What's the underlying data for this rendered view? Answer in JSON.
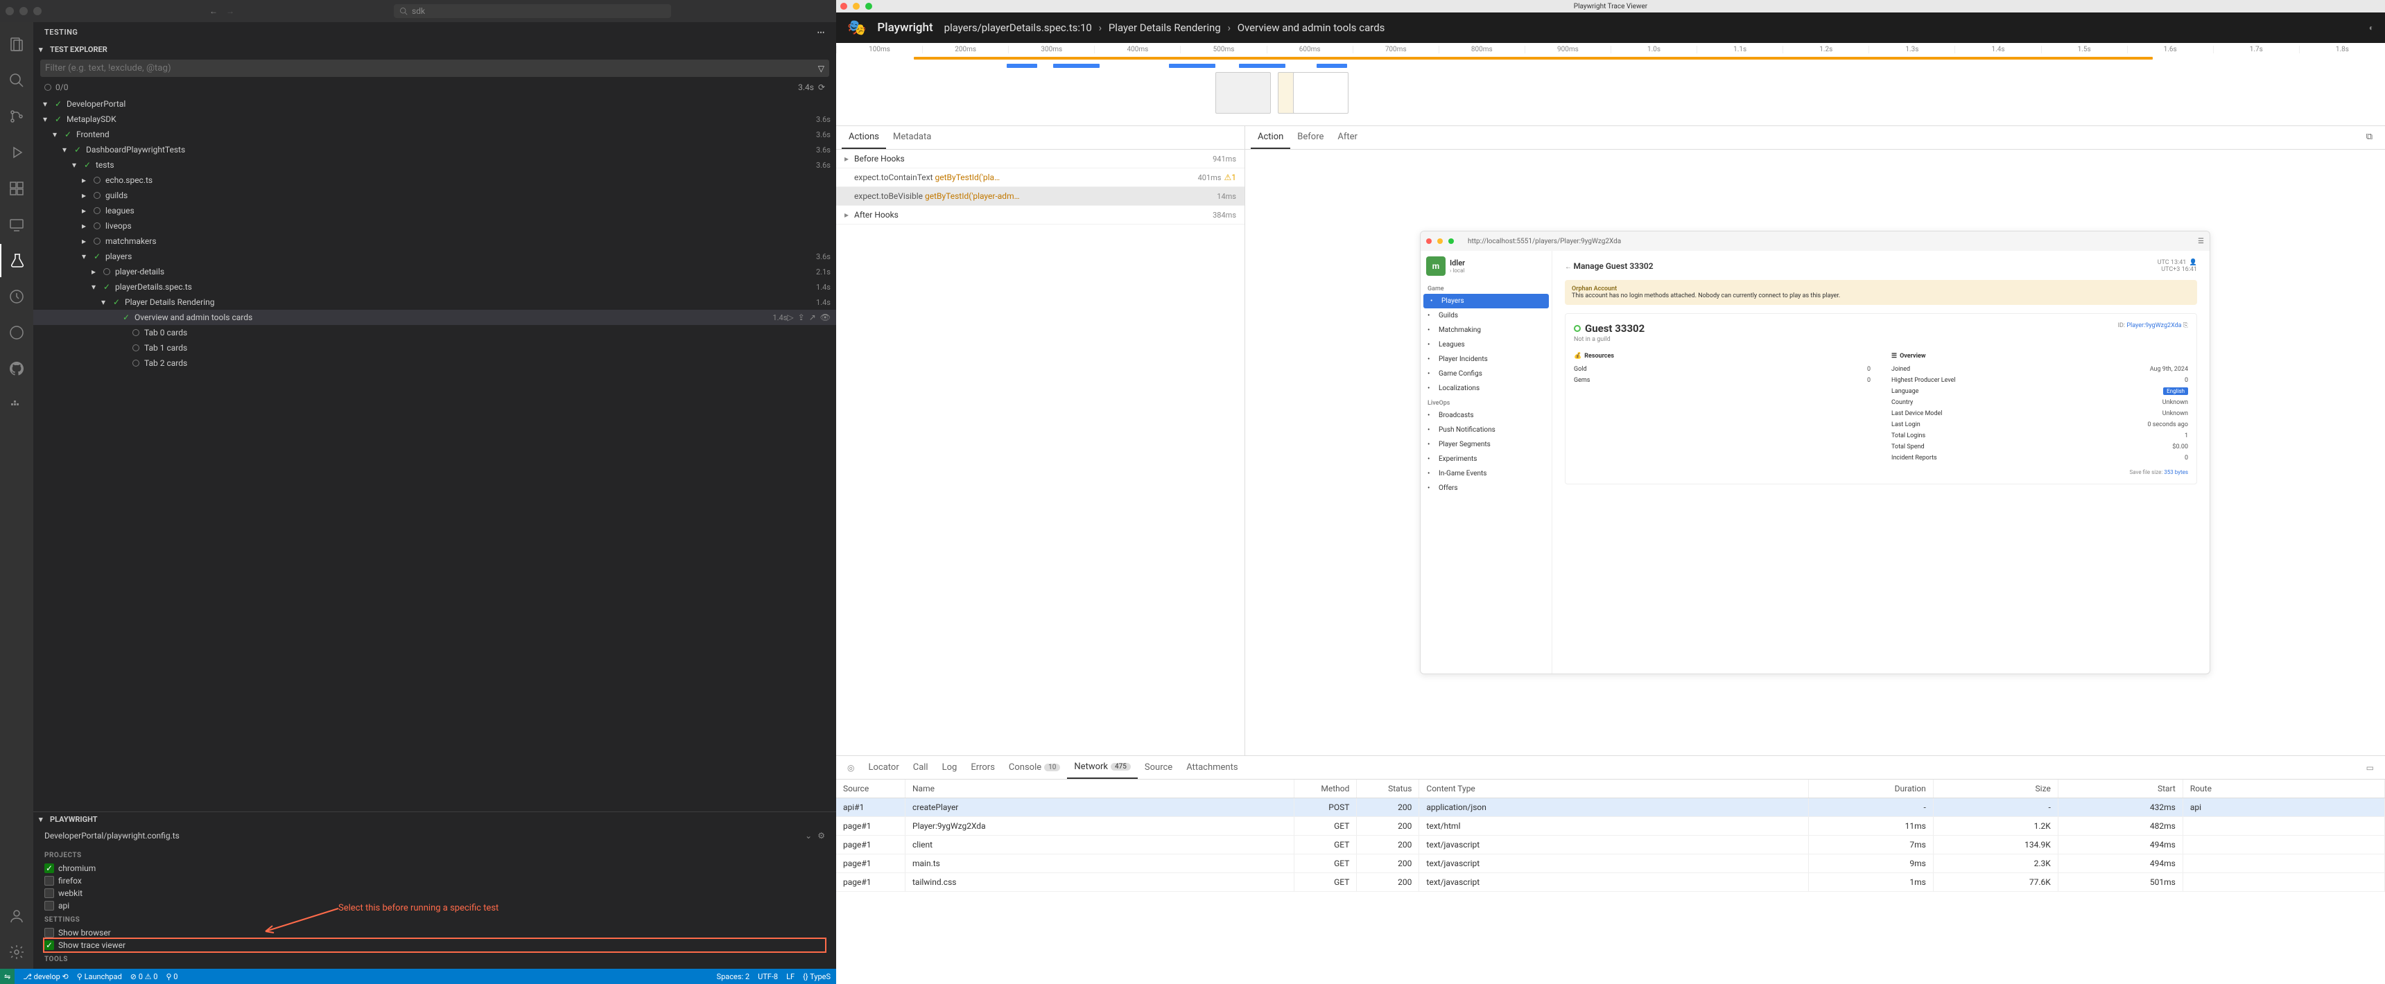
{
  "vscode": {
    "search_placeholder": "sdk",
    "testing_title": "TESTING",
    "test_explorer": "TEST EXPLORER",
    "filter_placeholder": "Filter (e.g. text, !exclude, @tag)",
    "status_count": "0/0",
    "status_time": "3.4s",
    "tree": [
      {
        "depth": 0,
        "expand": true,
        "status": "pass",
        "label": "DeveloperPortal",
        "time": ""
      },
      {
        "depth": 0,
        "expand": true,
        "status": "pass",
        "label": "MetaplaySDK",
        "time": "3.6s"
      },
      {
        "depth": 1,
        "expand": true,
        "status": "pass",
        "label": "Frontend",
        "time": "3.6s"
      },
      {
        "depth": 2,
        "expand": true,
        "status": "pass",
        "label": "DashboardPlaywrightTests",
        "time": "3.6s"
      },
      {
        "depth": 3,
        "expand": true,
        "status": "pass",
        "label": "tests",
        "time": "3.6s"
      },
      {
        "depth": 4,
        "expand": false,
        "status": "none",
        "label": "echo.spec.ts",
        "time": ""
      },
      {
        "depth": 4,
        "expand": false,
        "status": "none",
        "label": "guilds",
        "time": ""
      },
      {
        "depth": 4,
        "expand": false,
        "status": "none",
        "label": "leagues",
        "time": ""
      },
      {
        "depth": 4,
        "expand": false,
        "status": "none",
        "label": "liveops",
        "time": ""
      },
      {
        "depth": 4,
        "expand": false,
        "status": "none",
        "label": "matchmakers",
        "time": ""
      },
      {
        "depth": 4,
        "expand": true,
        "status": "pass",
        "label": "players",
        "time": "3.6s"
      },
      {
        "depth": 5,
        "expand": false,
        "status": "none",
        "label": "player-details",
        "time": "2.1s"
      },
      {
        "depth": 5,
        "expand": true,
        "status": "pass",
        "label": "playerDetails.spec.ts",
        "time": "1.4s"
      },
      {
        "depth": 6,
        "expand": true,
        "status": "pass",
        "label": "Player Details Rendering",
        "time": "1.4s"
      },
      {
        "depth": 7,
        "expand": false,
        "status": "pass",
        "label": "Overview and admin tools cards",
        "time": "1.4s",
        "selected": true,
        "actions": true
      },
      {
        "depth": 8,
        "expand": false,
        "status": "none",
        "label": "Tab 0 cards",
        "time": ""
      },
      {
        "depth": 8,
        "expand": false,
        "status": "none",
        "label": "Tab 1 cards",
        "time": ""
      },
      {
        "depth": 8,
        "expand": false,
        "status": "none",
        "label": "Tab 2 cards",
        "time": ""
      }
    ],
    "playwright_section": "PLAYWRIGHT",
    "config_path": "DeveloperPortal/playwright.config.ts",
    "projects_label": "PROJECTS",
    "projects": [
      {
        "name": "chromium",
        "checked": true
      },
      {
        "name": "firefox",
        "checked": false
      },
      {
        "name": "webkit",
        "checked": false
      },
      {
        "name": "api",
        "checked": false
      }
    ],
    "settings_label": "SETTINGS",
    "settings": [
      {
        "name": "Show browser",
        "checked": false
      },
      {
        "name": "Show trace viewer",
        "checked": true,
        "highlight": true
      }
    ],
    "tools_label": "TOOLS",
    "annotation_text": "Select this before running a specific test",
    "statusbar": {
      "branch": "develop",
      "launchpad": "Launchpad",
      "errors": "0",
      "warnings": "0",
      "ports": "0",
      "spaces": "Spaces: 2",
      "encoding": "UTF-8",
      "eol": "LF",
      "lang": "TypeS"
    }
  },
  "trace": {
    "window_title": "Playwright Trace Viewer",
    "header_title": "Playwright",
    "breadcrumbs": [
      "players/playerDetails.spec.ts:10",
      "Player Details Rendering",
      "Overview and admin tools cards"
    ],
    "timeline_ticks": [
      "100ms",
      "200ms",
      "300ms",
      "400ms",
      "500ms",
      "600ms",
      "700ms",
      "800ms",
      "900ms",
      "1.0s",
      "1.1s",
      "1.2s",
      "1.3s",
      "1.4s",
      "1.5s",
      "1.6s",
      "1.7s",
      "1.8s"
    ],
    "left_tabs": [
      "Actions",
      "Metadata"
    ],
    "left_tabs_active": 0,
    "actions": [
      {
        "chev": true,
        "label": "Before Hooks",
        "time": "941ms"
      },
      {
        "chev": false,
        "method": "expect.toContainText",
        "locator": "getByTestId('pla…",
        "time": "401ms",
        "warn": true
      },
      {
        "chev": false,
        "method": "expect.toBeVisible",
        "locator": "getByTestId('player-adm…",
        "time": "14ms",
        "selected": true
      },
      {
        "chev": true,
        "label": "After Hooks",
        "time": "384ms"
      }
    ],
    "right_tabs": [
      "Action",
      "Before",
      "After"
    ],
    "right_tabs_active": 0,
    "preview": {
      "url": "http://localhost:5551/players/Player:9ygWzg2Xda",
      "app_name": "Idler",
      "app_env": "local",
      "sidebar_sections": [
        {
          "title": "Game",
          "items": [
            "Players",
            "Guilds",
            "Matchmaking",
            "Leagues",
            "Player Incidents",
            "Game Configs",
            "Localizations"
          ]
        },
        {
          "title": "LiveOps",
          "items": [
            "Broadcasts",
            "Push Notifications",
            "Player Segments",
            "Experiments",
            "In-Game Events",
            "Offers"
          ]
        }
      ],
      "sidebar_active": "Players",
      "manage_title": "Manage Guest 33302",
      "time_utc": "UTC",
      "time_utc3": "UTC+3",
      "time_value": "13:41",
      "time_value2": "16:41",
      "warning_title": "Orphan Account",
      "warning_text": "This account has no login methods attached. Nobody can currently connect to play as this player.",
      "player_name": "Guest 33302",
      "player_sub": "Not in a guild",
      "player_id_label": "ID:",
      "player_id": "Player:9ygWzg2Xda",
      "resources_title": "Resources",
      "resources": [
        {
          "k": "Gold",
          "v": "0"
        },
        {
          "k": "Gems",
          "v": "0"
        }
      ],
      "overview_title": "Overview",
      "overview": [
        {
          "k": "Joined",
          "v": "Aug 9th, 2024"
        },
        {
          "k": "Highest Producer Level",
          "v": "0"
        },
        {
          "k": "Language",
          "v": "English",
          "badge": true
        },
        {
          "k": "Country",
          "v": "Unknown"
        },
        {
          "k": "Last Device Model",
          "v": "Unknown"
        },
        {
          "k": "Last Login",
          "v": "0 seconds ago"
        },
        {
          "k": "Total Logins",
          "v": "1"
        },
        {
          "k": "Total Spend",
          "v": "$0.00"
        },
        {
          "k": "Incident Reports",
          "v": "0"
        }
      ],
      "file_size_label": "Save file size:",
      "file_size": "353 bytes"
    },
    "bottom_tabs": [
      {
        "label": "Locator"
      },
      {
        "label": "Call"
      },
      {
        "label": "Log"
      },
      {
        "label": "Errors"
      },
      {
        "label": "Console",
        "count": "10"
      },
      {
        "label": "Network",
        "count": "475",
        "active": true
      },
      {
        "label": "Source"
      },
      {
        "label": "Attachments"
      }
    ],
    "net_columns": [
      "Source",
      "Name",
      "Method",
      "Status",
      "Content Type",
      "Duration",
      "Size",
      "Start",
      "Route"
    ],
    "net_rows": [
      {
        "source": "api#1",
        "name": "createPlayer",
        "method": "POST",
        "status": "200",
        "ctype": "application/json",
        "dur": "-",
        "size": "-",
        "start": "432ms",
        "route": "api",
        "selected": true
      },
      {
        "source": "page#1",
        "name": "Player:9ygWzg2Xda",
        "method": "GET",
        "status": "200",
        "ctype": "text/html",
        "dur": "11ms",
        "size": "1.2K",
        "start": "482ms",
        "route": ""
      },
      {
        "source": "page#1",
        "name": "client",
        "method": "GET",
        "status": "200",
        "ctype": "text/javascript",
        "dur": "7ms",
        "size": "134.9K",
        "start": "494ms",
        "route": ""
      },
      {
        "source": "page#1",
        "name": "main.ts",
        "method": "GET",
        "status": "200",
        "ctype": "text/javascript",
        "dur": "9ms",
        "size": "2.3K",
        "start": "494ms",
        "route": ""
      },
      {
        "source": "page#1",
        "name": "tailwind.css",
        "method": "GET",
        "status": "200",
        "ctype": "text/javascript",
        "dur": "1ms",
        "size": "77.6K",
        "start": "501ms",
        "route": ""
      }
    ]
  }
}
